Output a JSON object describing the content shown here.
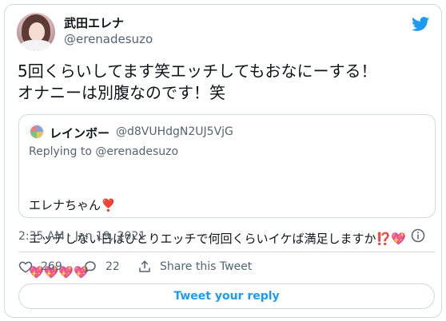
{
  "colors": {
    "accent": "#1d9bf0",
    "text": "#0f1419",
    "muted": "#536471",
    "border": "#cfd9de"
  },
  "author": {
    "name": "武田エレナ",
    "handle": "@erenadesuzo",
    "avatar_icon": "profile-photo"
  },
  "tweet": {
    "text": "5回くらいしてます笑エッチしてもおなにーする！\nオナニーは別腹なのです！笑"
  },
  "quote": {
    "avatar_icon": "profile-photo",
    "name": "レインボー",
    "handle": "@d8VUHdgN2UJ5VjG",
    "replying_prefix": "Replying to",
    "replying_handle": "@erenadesuzo",
    "line1": "エレナちゃん",
    "line1_emoji": "❣️",
    "line2": "エッチしない日はひとりエッチで何回くらいイケば満足しますか⁉️💖",
    "line3": "💖💖💖💖"
  },
  "meta": {
    "timestamp": "2:35 AM · Jan 19, 2021",
    "info_icon": "info-icon"
  },
  "actions": {
    "like_count": "269",
    "reply_count": "22",
    "share_label": "Share this Tweet"
  },
  "reply_button_label": "Tweet your reply",
  "logo_icon": "twitter-bird-icon"
}
